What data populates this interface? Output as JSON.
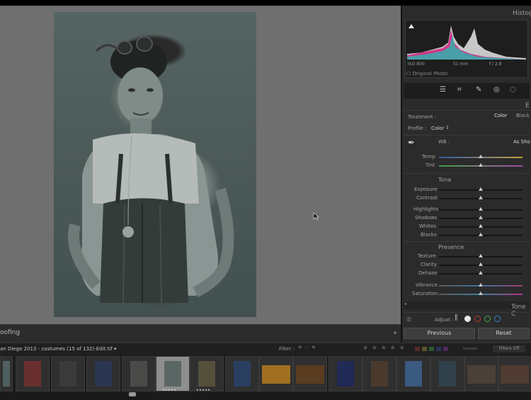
{
  "canvas": {
    "softproof_label": "oofing"
  },
  "panel": {
    "histogram_title": "Histog",
    "histogram_info": {
      "iso": "ISO 800",
      "focal": "51 mm",
      "aperture": "f / 2.8"
    },
    "original_photo": "Original Photo",
    "section_edge_label": "E",
    "treatment_label": "Treatment :",
    "treatment_color": "Color",
    "treatment_bw": "Black",
    "profile_label": "Profile :",
    "profile_value": "Color",
    "wb_label": "WB :",
    "wb_value": "As Sho",
    "temp_label": "Temp",
    "tint_label": "Tint",
    "tone_header": "Tone",
    "exposure": "Exposure",
    "contrast": "Contrast",
    "highlights": "Highlights",
    "shadows": "Shadows",
    "whites": "Whites",
    "blacks": "Blacks",
    "presence_header": "Presence",
    "texture": "Texture",
    "clarity": "Clarity",
    "dehaze": "Dehaze",
    "vibrance": "Vibrance",
    "saturation": "Saturation",
    "tone_curve_title": "Tone C",
    "adjust_label": "Adjust :",
    "previous_button": "Previous",
    "reset_button": "Reset"
  },
  "filmstrip": {
    "path": "an Diego 2013 - costumes (15 of 132)-Edit.tif ▾",
    "filter_label": "Filter :",
    "stars": "★ ★ ★ ★ ★",
    "filters_off": "Filters Off",
    "selected_stars": "★★★★★",
    "neighbor_stars": "★★★★★"
  },
  "colors": {
    "accent_red": "#c0392b",
    "accent_green": "#3fae4b",
    "accent_blue": "#3d7fd6"
  }
}
